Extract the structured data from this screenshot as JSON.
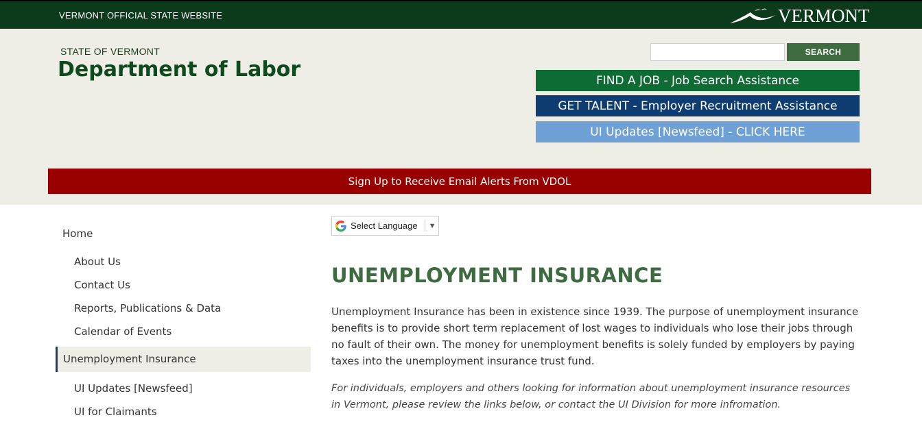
{
  "topbar": {
    "official_label": "VERMONT OFFICIAL STATE WEBSITE",
    "logo_text": "VERMONT",
    "logo_icon": "mountain-bird-icon"
  },
  "header": {
    "state_label": "STATE OF VERMONT",
    "dept_title": "Department of Labor",
    "search": {
      "value": "",
      "placeholder": "",
      "button_label": "SEARCH"
    },
    "cta": {
      "find_job": "FIND A JOB - Job Search Assistance",
      "get_talent": "GET TALENT - Employer Recruitment Assistance",
      "ui_updates": "UI Updates [Newsfeed] - CLICK HERE"
    },
    "alerts_label": "Sign Up to Receive Email Alerts From VDOL"
  },
  "sidebar": {
    "home": "Home",
    "items": [
      "About Us",
      "Contact Us",
      "Reports, Publications & Data",
      "Calendar of Events"
    ],
    "active": "Unemployment Insurance",
    "subitems": [
      "UI Updates [Newsfeed]",
      "UI for Claimants"
    ]
  },
  "translate": {
    "label": "Select Language",
    "icon": "google-g-icon"
  },
  "main": {
    "title": "UNEMPLOYMENT INSURANCE",
    "intro": "Unemployment Insurance has been in existence since 1939.  The purpose of unemployment insurance benefits is to provide short term replacement of lost wages to individuals who lose their jobs through no fault of their own. The money for unemployment benefits is solely funded by employers by paying taxes into the unemployment insurance trust fund.",
    "note": "For individuals, employers and others looking for information about unemployment insurance resources in Vermont, please review the links below, or contact the UI Division for more infromation."
  },
  "colors": {
    "topbar": "#0b3b1a",
    "header_bg": "#efeee6",
    "brand_green": "#0f4a1f",
    "find_job": "#0f6b34",
    "get_talent": "#0f3d72",
    "ui_updates": "#6fa0d6",
    "alerts": "#980000",
    "title_green": "#3f6b41"
  }
}
